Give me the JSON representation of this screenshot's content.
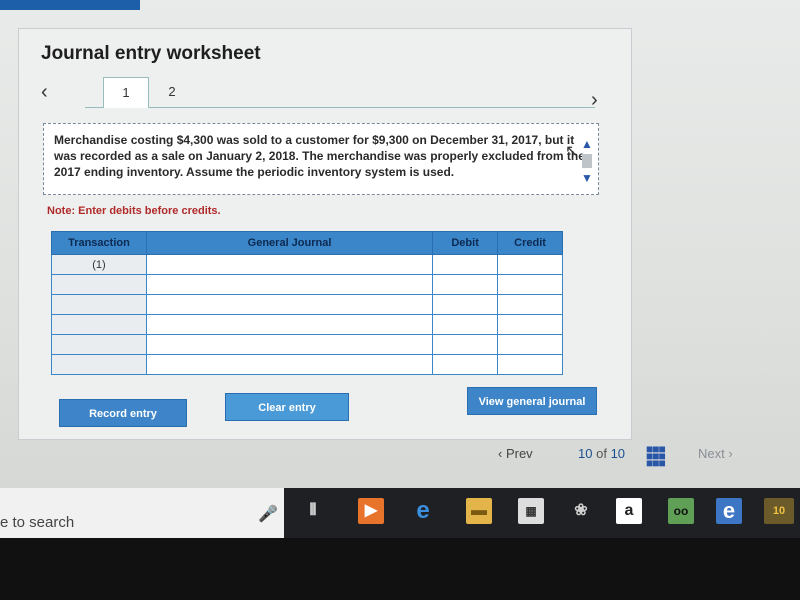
{
  "page": {
    "title": "Journal entry worksheet",
    "tabs": [
      "1",
      "2"
    ],
    "question_text": "Merchandise costing $4,300 was sold to a customer for $9,300 on December 31, 2017, but it was recorded as a sale on January 2, 2018. The merchandise was properly excluded from the 2017 ending inventory. Assume the periodic inventory system is used.",
    "note": "Note: Enter debits before credits."
  },
  "table": {
    "headers": [
      "Transaction",
      "General Journal",
      "Debit",
      "Credit"
    ],
    "rows": [
      {
        "transaction": "(1)",
        "account": "",
        "debit": "",
        "credit": ""
      },
      {
        "transaction": "",
        "account": "",
        "debit": "",
        "credit": ""
      },
      {
        "transaction": "",
        "account": "",
        "debit": "",
        "credit": ""
      },
      {
        "transaction": "",
        "account": "",
        "debit": "",
        "credit": ""
      },
      {
        "transaction": "",
        "account": "",
        "debit": "",
        "credit": ""
      },
      {
        "transaction": "",
        "account": "",
        "debit": "",
        "credit": ""
      }
    ]
  },
  "buttons": {
    "record": "Record entry",
    "clear": "Clear entry",
    "view": "View general journal"
  },
  "pager": {
    "prev": "Prev",
    "current": "10",
    "of": "of",
    "total": "10",
    "next": "Next"
  },
  "taskbar": {
    "search_text": "e to search",
    "amazon_label": "a",
    "badge_label": "10"
  },
  "colors": {
    "accent": "#3d85c8",
    "note": "#b02a2a"
  },
  "icons": [
    "chevron-left-icon",
    "chevron-right-icon",
    "scroll-up-icon",
    "scroll-down-icon",
    "mouse-cursor-icon",
    "grid-icon",
    "microphone-icon",
    "task-view-icon",
    "media-icon",
    "edge-icon",
    "file-explorer-icon",
    "store-icon",
    "shell-app-icon",
    "amazon-icon",
    "tripadvisor-icon",
    "edge-alt-icon"
  ]
}
